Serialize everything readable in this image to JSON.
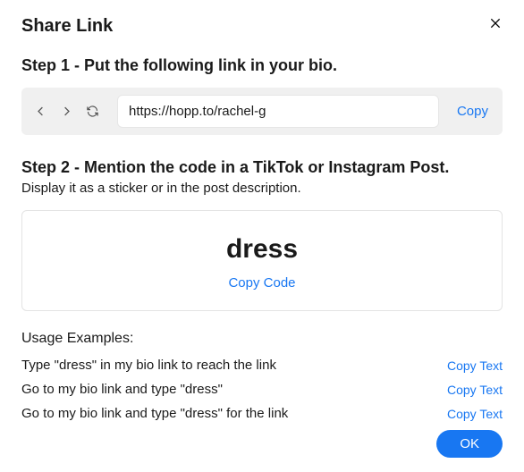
{
  "title": "Share Link",
  "step1": {
    "heading": "Step 1 - Put the following link in your bio.",
    "url": "https://hopp.to/rachel-g",
    "copy_label": "Copy"
  },
  "step2": {
    "heading": "Step 2 - Mention the code in a TikTok or Instagram Post.",
    "subtext": "Display it as a sticker or in the post description.",
    "code": "dress",
    "copy_code_label": "Copy Code"
  },
  "usage": {
    "title": "Usage Examples:",
    "examples": [
      "Type \"dress\" in my bio link to reach the link",
      "Go to my bio link and type \"dress\"",
      "Go to my bio link and type \"dress\" for the link"
    ],
    "copy_text_label": "Copy Text"
  },
  "ok_label": "OK"
}
